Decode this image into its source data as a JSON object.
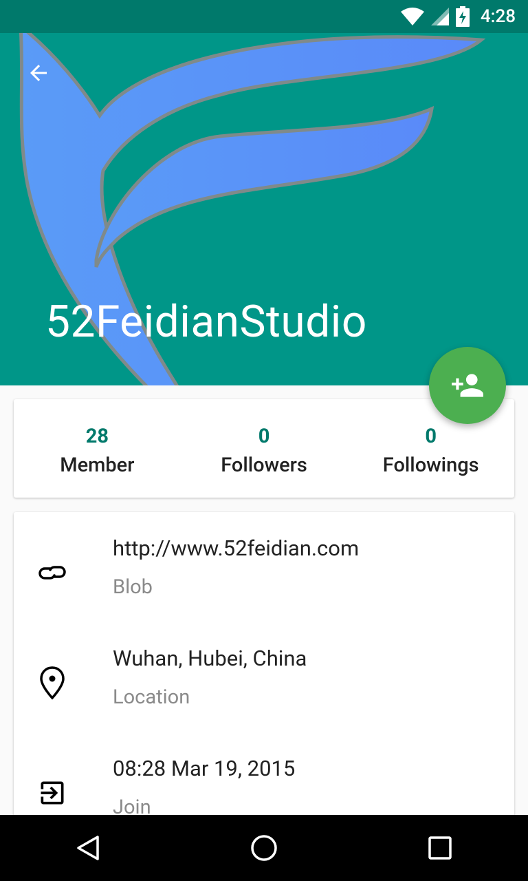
{
  "status_bar": {
    "time": "4:28",
    "icons": [
      "wifi-icon",
      "cell-signal-icon",
      "battery-charging-icon"
    ]
  },
  "header": {
    "title": "52FeidianStudio",
    "background_color": "#009688",
    "back_icon": "arrow-back-icon",
    "logo_color": "#5b8ff9"
  },
  "fab": {
    "icon": "person-add-icon",
    "color": "#4caf50"
  },
  "stats": [
    {
      "value": "28",
      "label": "Member"
    },
    {
      "value": "0",
      "label": "Followers"
    },
    {
      "value": "0",
      "label": "Followings"
    }
  ],
  "details": [
    {
      "icon": "link-icon",
      "value": "http://www.52feidian.com",
      "label": "Blob"
    },
    {
      "icon": "location-pin-icon",
      "value": "Wuhan, Hubei, China",
      "label": "Location"
    },
    {
      "icon": "exit-to-app-icon",
      "value": "08:28 Mar 19, 2015",
      "label": "Join"
    }
  ],
  "nav_bar": {
    "buttons": [
      "back-triangle-icon",
      "home-circle-icon",
      "recents-square-icon"
    ]
  },
  "colors": {
    "primary": "#009688",
    "primary_dark": "#00796b",
    "accent": "#4caf50",
    "stat_number": "#00796b"
  }
}
